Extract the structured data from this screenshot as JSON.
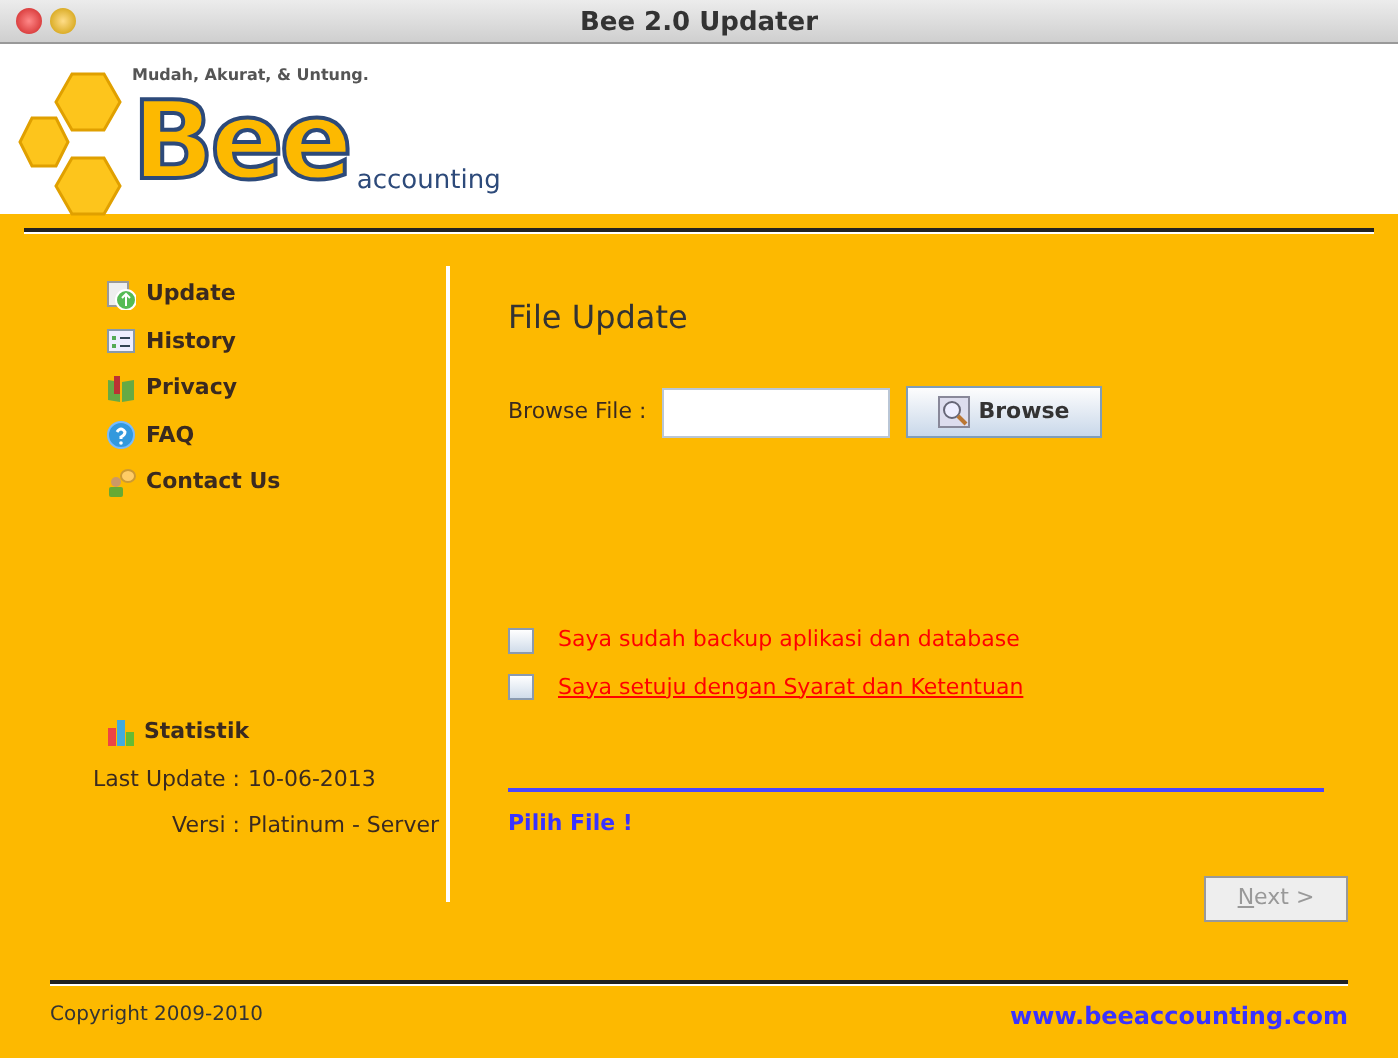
{
  "window": {
    "title": "Bee 2.0 Updater"
  },
  "header": {
    "tagline": "Mudah, Akurat, & Untung.",
    "logo_text": "Bee",
    "logo_subtext": "accounting"
  },
  "sidebar": {
    "items": [
      {
        "label": "Update",
        "kind": "update"
      },
      {
        "label": "History",
        "kind": "history"
      },
      {
        "label": "Privacy",
        "kind": "privacy"
      },
      {
        "label": "FAQ",
        "kind": "faq"
      },
      {
        "label": "Contact Us",
        "kind": "contact"
      }
    ],
    "statistik": {
      "label": "Statistik",
      "rows": [
        {
          "label": "Last Update :",
          "value": "10-06-2013"
        },
        {
          "label": "Versi :",
          "value": "Platinum - Server"
        }
      ]
    }
  },
  "main": {
    "title": "File Update",
    "browse_label": "Browse File :",
    "browse_button": "Browse",
    "checkboxes": [
      {
        "label": "Saya sudah backup aplikasi dan database",
        "checked": false,
        "kind": "text"
      },
      {
        "label": "Saya setuju dengan Syarat dan Ketentuan",
        "checked": false,
        "kind": "link"
      }
    ],
    "status": "Pilih File !",
    "next_button": {
      "label": "Next >",
      "disabled": true
    }
  },
  "footer": {
    "copyright": "Copyright 2009-2010",
    "url": "www.beeaccounting.com"
  }
}
